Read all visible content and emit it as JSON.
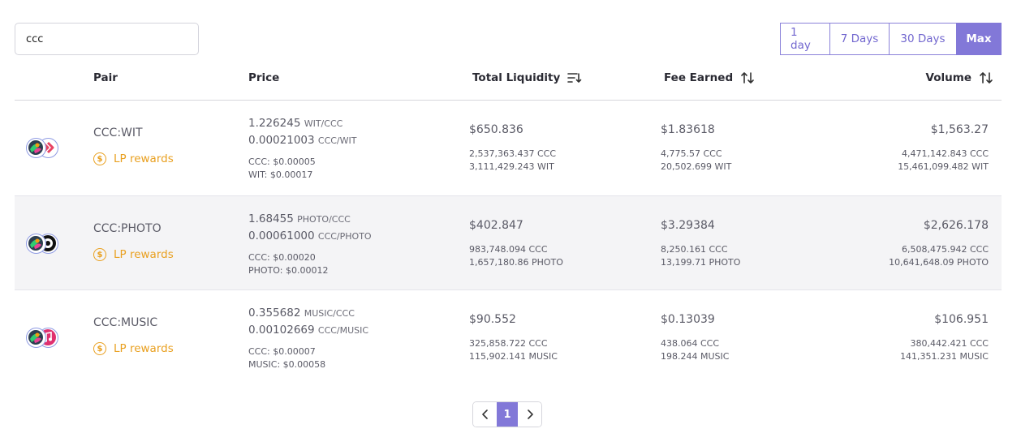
{
  "search": {
    "value": "ccc"
  },
  "time_range": {
    "options": [
      "1 day",
      "7 Days",
      "30 Days",
      "Max"
    ],
    "selected": "Max"
  },
  "table": {
    "headers": {
      "pair": "Pair",
      "price": "Price",
      "total_liquidity": "Total Liquidity",
      "fee_earned": "Fee Earned",
      "volume": "Volume"
    },
    "rows": [
      {
        "pair": "CCC:WIT",
        "lp_label": "LP rewards",
        "price1": "1.226245",
        "price1_unit": "WIT/CCC",
        "price2": "0.00021003",
        "price2_unit": "CCC/WIT",
        "usd1": "CCC: $0.00005",
        "usd2": "WIT: $0.00017",
        "liquidity": "$650.836",
        "liquidity_a": "2,537,363.437 CCC",
        "liquidity_b": "3,111,429.243 WIT",
        "fee": "$1.83618",
        "fee_a": "4,775.57 CCC",
        "fee_b": "20,502.699 WIT",
        "volume": "$1,563.27",
        "volume_a": "4,471,142.843 CCC",
        "volume_b": "15,461,099.482 WIT"
      },
      {
        "pair": "CCC:PHOTO",
        "lp_label": "LP rewards",
        "price1": "1.68455",
        "price1_unit": "PHOTO/CCC",
        "price2": "0.00061000",
        "price2_unit": "CCC/PHOTO",
        "usd1": "CCC: $0.00020",
        "usd2": "PHOTO: $0.00012",
        "liquidity": "$402.847",
        "liquidity_a": "983,748.094 CCC",
        "liquidity_b": "1,657,180.86 PHOTO",
        "fee": "$3.29384",
        "fee_a": "8,250.161 CCC",
        "fee_b": "13,199.71 PHOTO",
        "volume": "$2,626.178",
        "volume_a": "6,508,475.942 CCC",
        "volume_b": "10,641,648.09 PHOTO"
      },
      {
        "pair": "CCC:MUSIC",
        "lp_label": "LP rewards",
        "price1": "0.355682",
        "price1_unit": "MUSIC/CCC",
        "price2": "0.00102669",
        "price2_unit": "CCC/MUSIC",
        "usd1": "CCC: $0.00007",
        "usd2": "MUSIC: $0.00058",
        "liquidity": "$90.552",
        "liquidity_a": "325,858.722 CCC",
        "liquidity_b": "115,902.141 MUSIC",
        "fee": "$0.13039",
        "fee_a": "438.064 CCC",
        "fee_b": "198.244 MUSIC",
        "volume": "$106.951",
        "volume_a": "380,442.421 CCC",
        "volume_b": "141,351.231 MUSIC"
      }
    ]
  },
  "pagination": {
    "current": "1"
  },
  "colors": {
    "accent": "#8278d8",
    "reward": "#e9a020",
    "row_alt": "#f4f4f6"
  }
}
